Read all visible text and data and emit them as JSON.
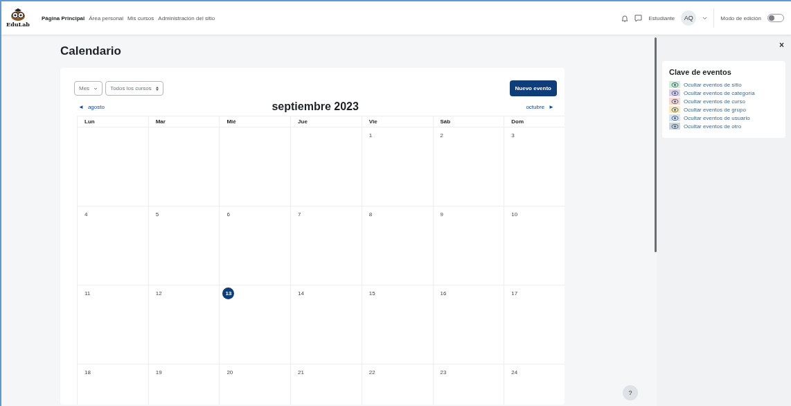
{
  "header": {
    "logo_text": "EduLab",
    "nav": [
      {
        "label": "Página Principal",
        "selected": true
      },
      {
        "label": "Área personal",
        "selected": false
      },
      {
        "label": "Mis cursos",
        "selected": false
      },
      {
        "label": "Administración del sitio",
        "selected": false
      }
    ],
    "role": "Estudiante",
    "avatar": "AQ",
    "edit_mode": {
      "label": "Modo de edición",
      "on": false
    }
  },
  "page_title": "Calendario",
  "calendar": {
    "view_select": "Mes",
    "course_select": "Todos los cursos",
    "new_event": "Nuevo evento",
    "prev": "agosto",
    "prev_icon": "◄",
    "month": "septiembre 2023",
    "next": "octubre",
    "next_icon": "►",
    "weekdays": [
      "Lun",
      "Mar",
      "Mié",
      "Jue",
      "Vie",
      "Sáb",
      "Dom"
    ],
    "weeks": [
      [
        {
          "day": "1",
          "today": false
        },
        {
          "day": "2",
          "today": false
        },
        {
          "day": "3",
          "today": false
        }
      ],
      [
        {
          "day": "4",
          "today": false
        },
        {
          "day": "5",
          "today": false
        },
        {
          "day": "6",
          "today": false
        },
        {
          "day": "7",
          "today": false
        },
        {
          "day": "8",
          "today": false
        },
        {
          "day": "9",
          "today": false
        },
        {
          "day": "10",
          "today": false
        }
      ],
      [
        {
          "day": "11",
          "today": false
        },
        {
          "day": "12",
          "today": false
        },
        {
          "day": "13",
          "today": true
        },
        {
          "day": "14",
          "today": false
        },
        {
          "day": "15",
          "today": false
        },
        {
          "day": "16",
          "today": false
        },
        {
          "day": "17",
          "today": false
        }
      ],
      [
        {
          "day": "18",
          "today": false
        },
        {
          "day": "19",
          "today": false
        },
        {
          "day": "20",
          "today": false
        },
        {
          "day": "21",
          "today": false
        },
        {
          "day": "22",
          "today": false
        },
        {
          "day": "23",
          "today": false
        },
        {
          "day": "24",
          "today": false
        }
      ]
    ]
  },
  "drawer": {
    "close": "×",
    "title": "Clave de eventos",
    "items": [
      {
        "label": "Ocultar eventos de sitio",
        "color": "#d1f0d4"
      },
      {
        "label": "Ocultar eventos de categoría",
        "color": "#e1d2ea"
      },
      {
        "label": "Ocultar eventos de curso",
        "color": "#fbd7cd"
      },
      {
        "label": "Ocultar eventos de grupo",
        "color": "#fdeab7"
      },
      {
        "label": "Ocultar eventos de usuario",
        "color": "#d8e4ef"
      },
      {
        "label": "Ocultar eventos de otro",
        "color": "#ced4da"
      }
    ]
  },
  "help": "?"
}
